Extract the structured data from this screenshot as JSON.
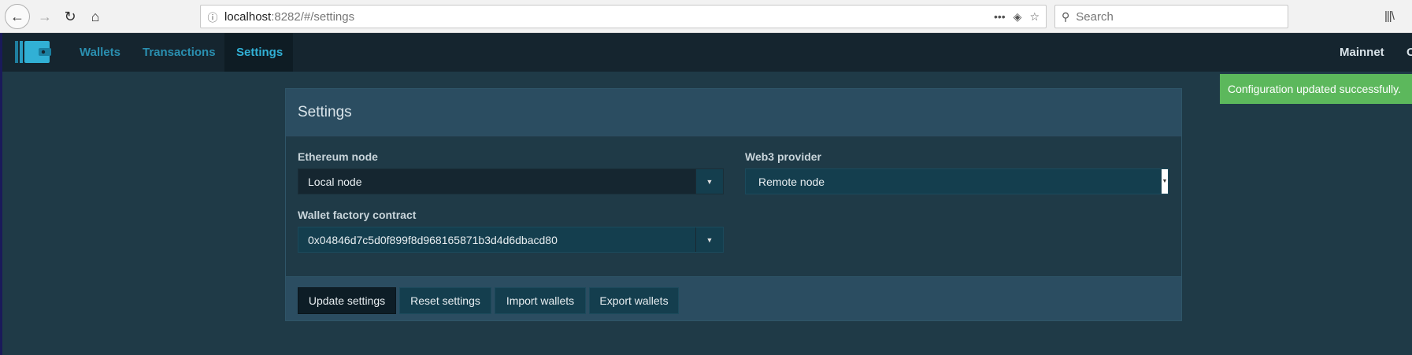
{
  "browser": {
    "url_host": "localhost",
    "url_rest": ":8282/#/settings",
    "search_placeholder": "Search",
    "back_glyph": "←",
    "forward_glyph": "→",
    "reload_glyph": "↻",
    "home_glyph": "⌂",
    "info_glyph": "ⓘ",
    "more_glyph": "•••",
    "pocket_glyph": "◈",
    "star_glyph": "☆",
    "search_glyph": "⚲",
    "library_glyph": "|||\\"
  },
  "nav": {
    "items": [
      {
        "label": "Wallets"
      },
      {
        "label": "Transactions"
      },
      {
        "label": "Settings"
      }
    ],
    "network": "Mainnet",
    "overflow": "O"
  },
  "toast": {
    "message": "Configuration updated successfully."
  },
  "settings": {
    "title": "Settings",
    "ethereum_node": {
      "label": "Ethereum node",
      "value": "Local node"
    },
    "web3_provider": {
      "label": "Web3 provider",
      "value": "Remote node"
    },
    "wallet_factory": {
      "label": "Wallet factory contract",
      "value": "0x04846d7c5d0f899f8d968165871b3d4d6dbacd80"
    },
    "caret_glyph": "▼",
    "buttons": {
      "update": "Update settings",
      "reset": "Reset settings",
      "import": "Import wallets",
      "export": "Export wallets"
    }
  },
  "colors": {
    "accent": "#31b0d5",
    "success": "#5cb85c",
    "navbar": "#15252f",
    "panel_header": "#2b4d61"
  }
}
